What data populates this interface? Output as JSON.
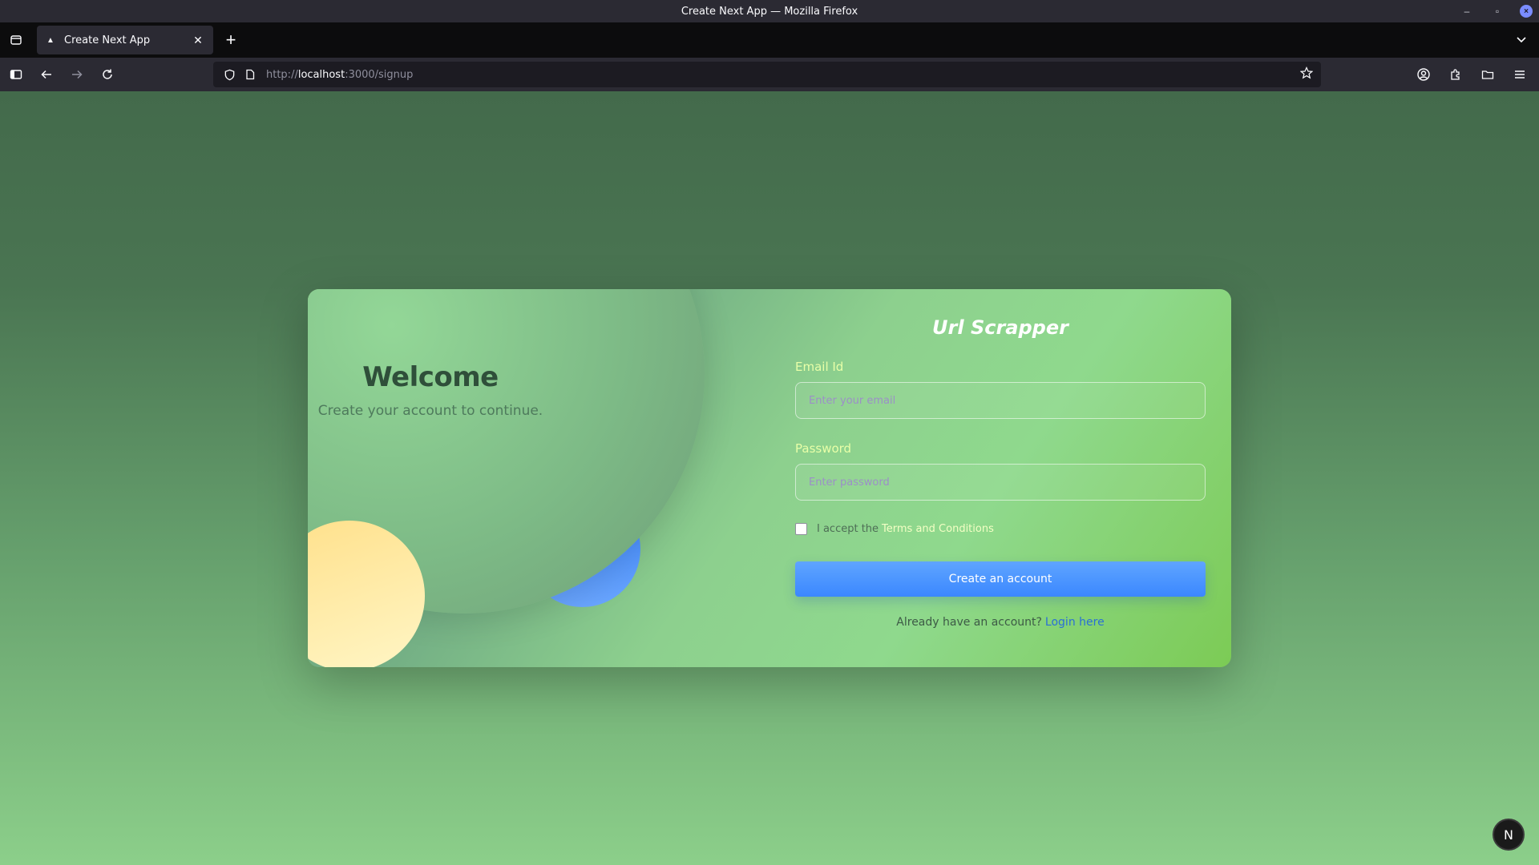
{
  "window": {
    "title": "Create Next App — Mozilla Firefox"
  },
  "tabs": [
    {
      "title": "Create Next App",
      "active": true
    }
  ],
  "urlbar": {
    "prefix": "http://",
    "host": "localhost",
    "path": ":3000/signup"
  },
  "card": {
    "welcome_title": "Welcome",
    "welcome_subtitle": "Create your account to continue.",
    "app_title": "Url Scrapper",
    "email_label": "Email Id",
    "email_placeholder": "Enter your email",
    "password_label": "Password",
    "password_placeholder": "Enter password",
    "terms_prefix": "I accept the",
    "terms_link": "Terms and Conditions",
    "terms_checked": false,
    "submit_label": "Create an account",
    "login_prompt": "Already have an account?",
    "login_link": "Login here"
  },
  "next_badge": "N",
  "colors": {
    "accent_blue": "#3b87ff",
    "login_link": "#2a6fd6",
    "yellow_circle": "#ffe08a"
  }
}
